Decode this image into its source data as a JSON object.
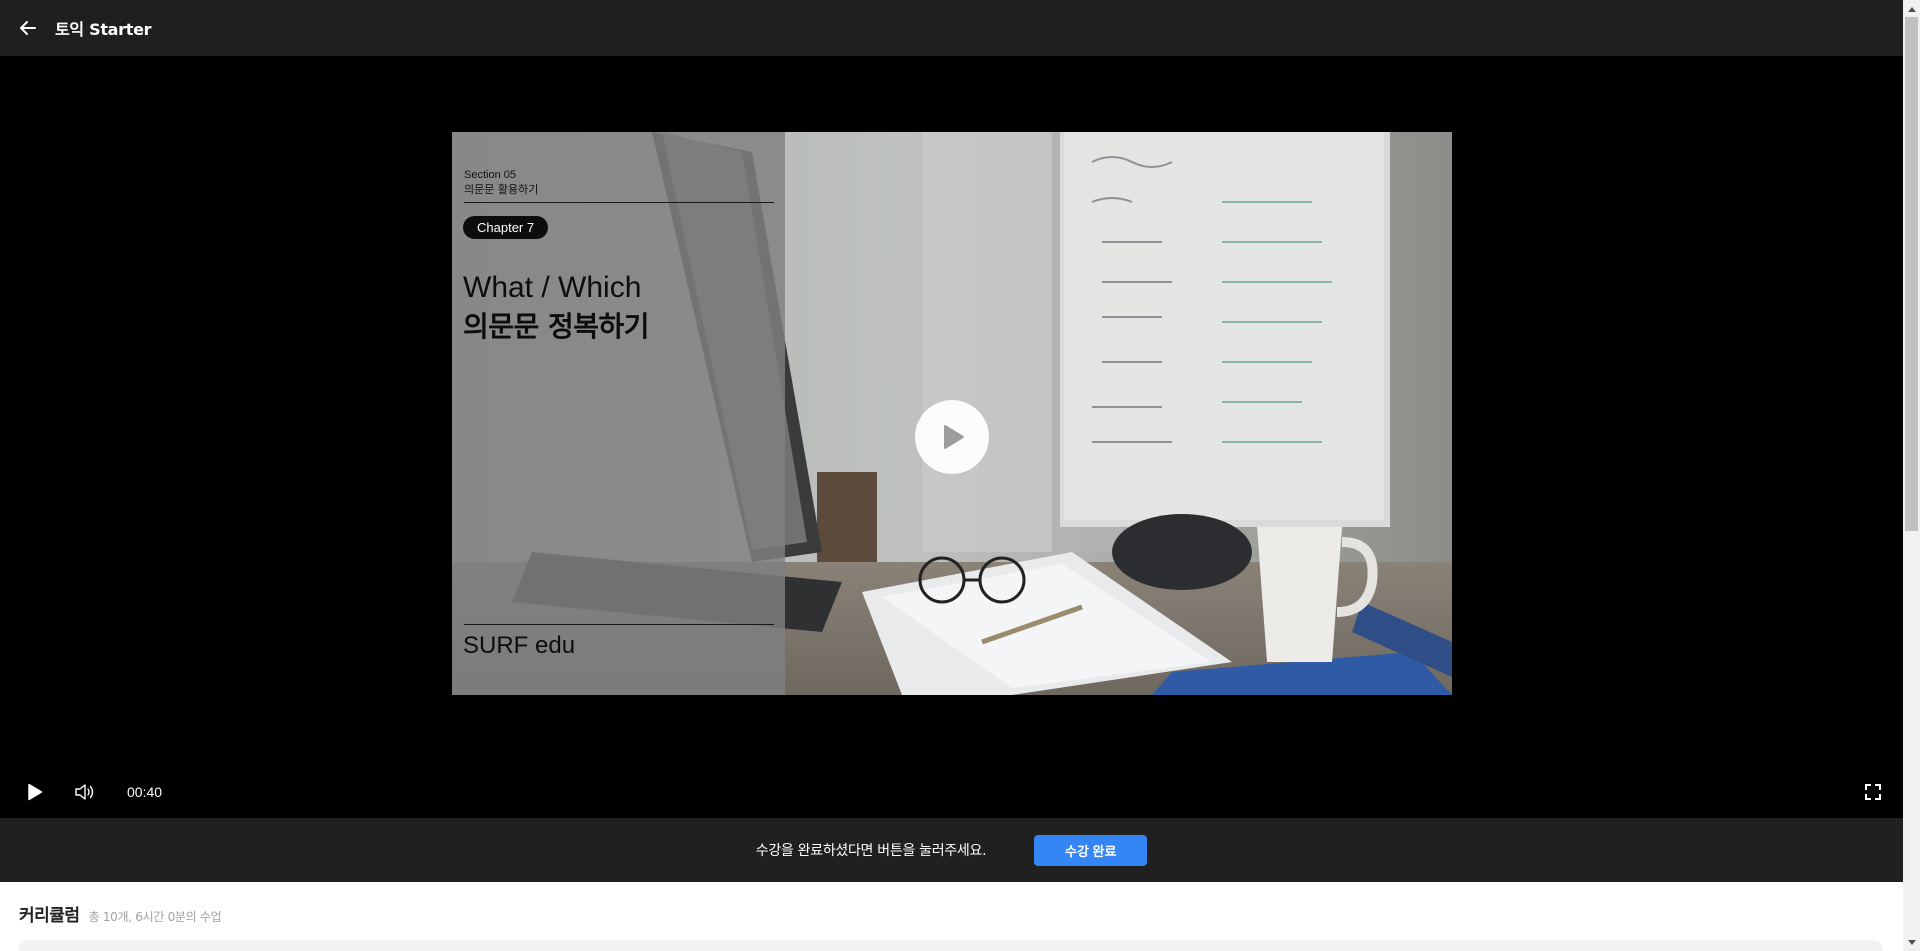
{
  "header": {
    "back_icon": "arrow-left-icon",
    "title": "토익 Starter"
  },
  "video": {
    "section_label": "Section 05",
    "section_subtitle": "의문문 활용하기",
    "chapter_label": "Chapter 7",
    "title_line_1": "What / Which",
    "title_line_2": "의문문 정복하기",
    "brand": "SURF edu",
    "play_icon": "play-icon"
  },
  "controls": {
    "play_icon": "play-icon",
    "volume_icon": "volume-icon",
    "time": "00:40",
    "fullscreen_icon": "fullscreen-icon"
  },
  "completion": {
    "message": "수강을 완료하셨다면 버튼을 눌러주세요.",
    "button_label": "수강 완료",
    "button_color": "#3586f5"
  },
  "curriculum": {
    "title": "커리큘럼",
    "summary": "총 10개, 6시간 0분의 수업"
  },
  "colors": {
    "header_bg": "#1f1f1f",
    "completion_bar_bg": "#202020"
  }
}
